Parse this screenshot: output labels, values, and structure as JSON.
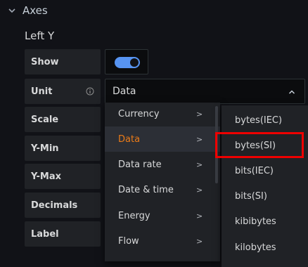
{
  "section": {
    "title": "Axes"
  },
  "axis": {
    "title": "Left Y"
  },
  "fields": {
    "show_label": "Show",
    "unit_label": "Unit",
    "scale_label": "Scale",
    "ymin_label": "Y-Min",
    "ymax_label": "Y-Max",
    "decimals_label": "Decimals",
    "label_label": "Label"
  },
  "show_toggle": {
    "on": true
  },
  "unit": {
    "value": "Data"
  },
  "menu_categories": [
    {
      "label": "Currency",
      "arrow": ">"
    },
    {
      "label": "Data",
      "arrow": ">",
      "active": true
    },
    {
      "label": "Data rate",
      "arrow": ">"
    },
    {
      "label": "Date & time",
      "arrow": ">"
    },
    {
      "label": "Energy",
      "arrow": ">"
    },
    {
      "label": "Flow",
      "arrow": ">"
    }
  ],
  "menu_units": [
    "bytes(IEC)",
    "bytes(SI)",
    "bits(IEC)",
    "bits(SI)",
    "kibibytes",
    "kilobytes"
  ],
  "highlighted_option": "bytes(SI)",
  "colors": {
    "background": "#111217",
    "accent_blue": "#5794f2",
    "active_orange": "#eb7b18",
    "highlight_red": "#ee0000"
  }
}
